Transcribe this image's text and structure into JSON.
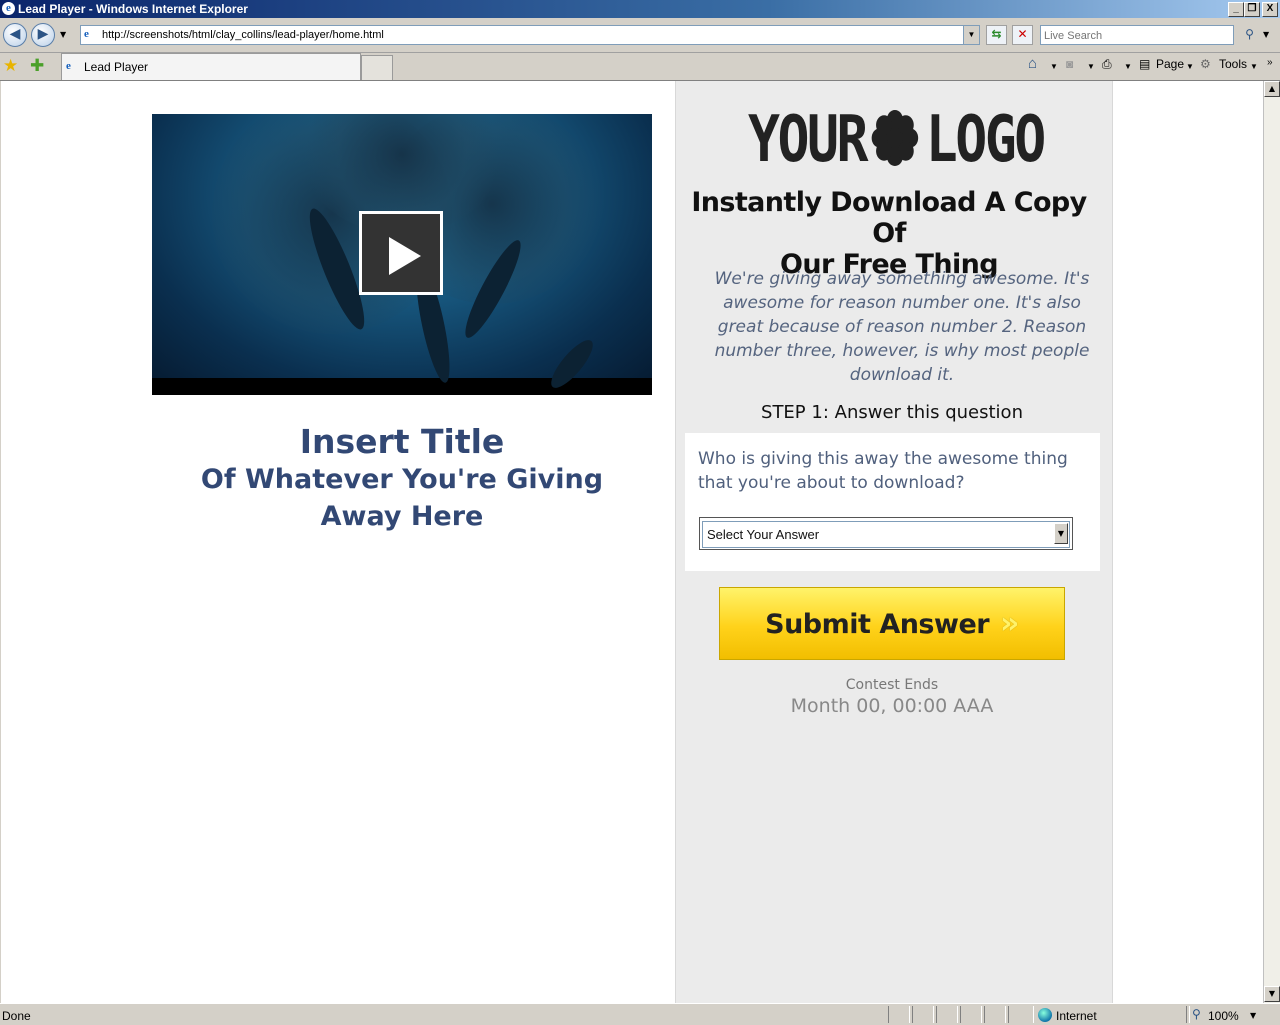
{
  "window": {
    "title": "Lead Player - Windows Internet Explorer",
    "minimize": "_",
    "restore": "❐",
    "close": "X"
  },
  "nav": {
    "back_icon": "back-arrow-icon",
    "forward_icon": "forward-arrow-icon",
    "address": "http://screenshots/html/clay_collins/lead-player/home.html",
    "search_placeholder": "Live Search"
  },
  "tabs": [
    {
      "label": "Lead Player"
    }
  ],
  "command_bar": {
    "page_label": "Page",
    "tools_label": "Tools"
  },
  "page": {
    "video": {
      "play_icon": "play-icon"
    },
    "left_title": {
      "line1": "Insert Title",
      "line2": "Of Whatever You're Giving",
      "line3": "Away Here"
    },
    "logo": {
      "left": "YOUR",
      "right": "LOGO"
    },
    "headline_1": "Instantly Download A Copy Of",
    "headline_2": "Our Free Thing",
    "description": "We're giving away something awesome. It's awesome for reason number one. It's also great because of reason number 2. Reason number three, however, is why most people download it.",
    "step": "STEP 1: Answer this question",
    "question": "Who is giving this away the awesome thing that you're about to download?",
    "select": {
      "selected": "Select Your Answer"
    },
    "submit": {
      "label": "Submit Answer",
      "chevrons": "»"
    },
    "contest_label": "Contest Ends",
    "contest_date": "Month 00, 00:00 AAA"
  },
  "status": {
    "left": "Done",
    "zone": "Internet",
    "zoom": "100%"
  },
  "colors": {
    "title_blue": "#324874",
    "desc_gray": "#55647f",
    "panel_bg": "#ebebeb",
    "button_yellow": "#ffd21a"
  }
}
